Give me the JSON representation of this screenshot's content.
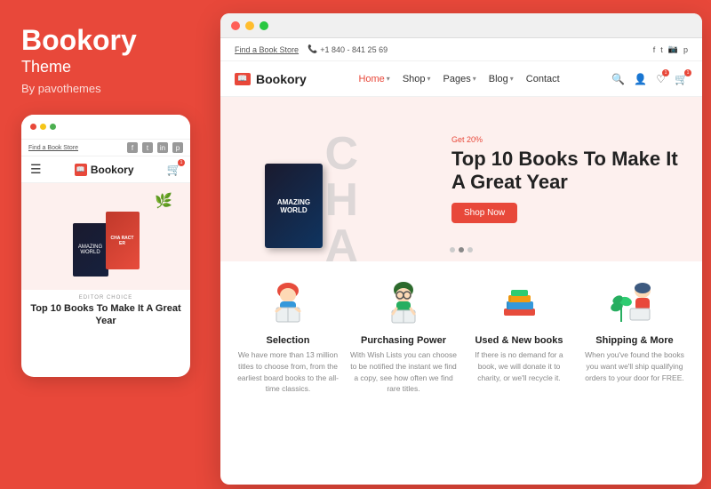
{
  "leftPanel": {
    "title": "Bookory",
    "subtitle": "Theme",
    "by": "By pavothemes"
  },
  "mobileTopBar": {
    "findLink": "Find a Book Store",
    "dots": [
      "red",
      "yellow",
      "green"
    ]
  },
  "mobileLogo": "Bookory",
  "mobileHero": {
    "editorLabel": "EDITOR CHOICE",
    "title": "Top 10 Books To Make It A Great Year"
  },
  "browserTopBar": {
    "phone": "+1 840 - 841 25 69",
    "findLink": "Find a Book Store",
    "socialIcons": [
      "f",
      "t",
      "in",
      "p"
    ]
  },
  "navbar": {
    "logo": "Bookory",
    "links": [
      {
        "label": "Home",
        "active": true,
        "hasArrow": true
      },
      {
        "label": "Shop",
        "hasArrow": true
      },
      {
        "label": "Pages",
        "hasArrow": true
      },
      {
        "label": "Blog",
        "hasArrow": true
      },
      {
        "label": "Contact",
        "hasArrow": false
      }
    ]
  },
  "hero": {
    "smallText": "Get 20%",
    "title": "Top 10 Books To Make It A Great Year",
    "buttonLabel": "Shop Now"
  },
  "features": [
    {
      "id": "selection",
      "title": "Selection",
      "desc": "We have more than 13 million titles to choose from, from the earliest board books to the all-time classics.",
      "icon": "📖"
    },
    {
      "id": "purchasing-power",
      "title": "Purchasing Power",
      "desc": "With Wish Lists you can choose to be notified the instant we find a copy, see how often we find rare titles.",
      "icon": "📚"
    },
    {
      "id": "used-new-books",
      "title": "Used & New books",
      "desc": "If there is no demand for a book, we will donate it to charity, or we'll recycle it.",
      "icon": "📦"
    },
    {
      "id": "shipping",
      "title": "Shipping & More",
      "desc": "When you've found the books you want we'll ship qualifying orders to your door for FREE.",
      "icon": "🚚"
    }
  ]
}
